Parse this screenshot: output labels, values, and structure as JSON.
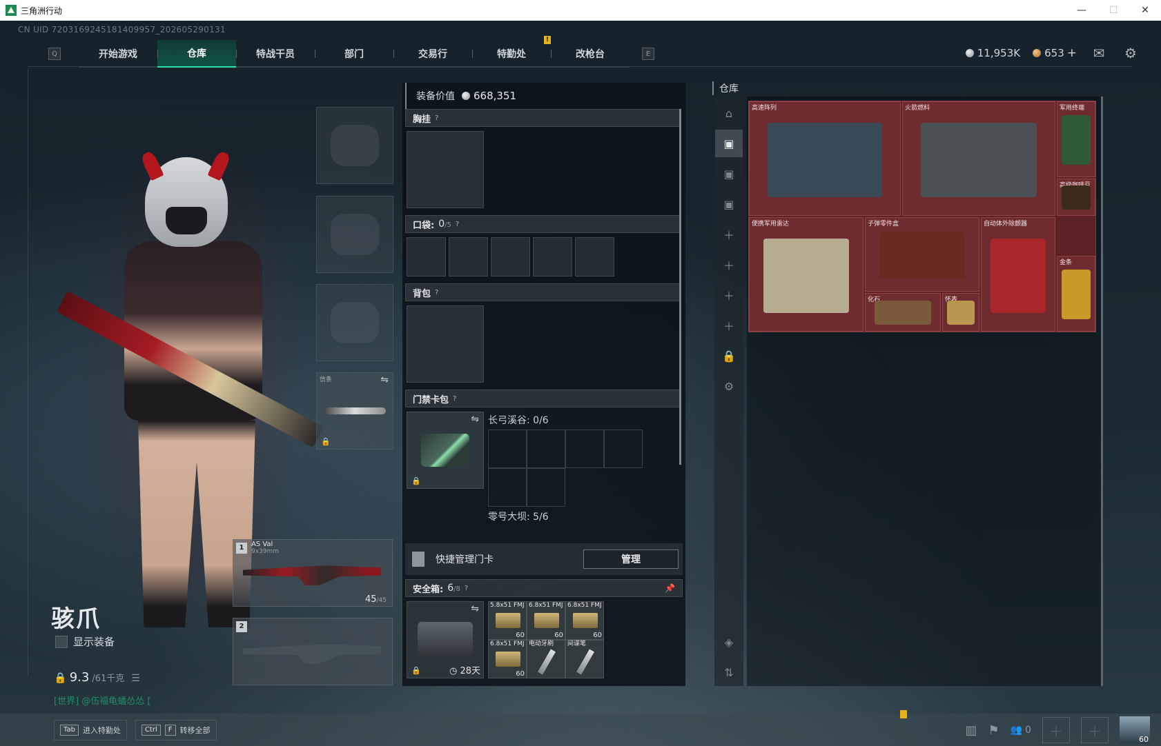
{
  "window": {
    "title": "三角洲行动",
    "minimize": "—",
    "maximize": "☐",
    "close": "✕"
  },
  "uid": "CN UID 7203169245181409957_202605290131",
  "nav": {
    "left_key": "Q",
    "right_key": "E",
    "tabs": [
      "开始游戏",
      "仓库",
      "特战干员",
      "部门",
      "交易行",
      "特勤处",
      "改枪台"
    ],
    "active_tab": "仓库",
    "alert_on": "特勤处",
    "alert_mark": "!"
  },
  "currency": {
    "silver": "11,953K",
    "bronze": "653",
    "plus": "+"
  },
  "operator": {
    "name": "骇爪",
    "show_gear_label": "显示装备",
    "weight": "9.3",
    "weight_unit": "/61千克",
    "chat": "[世界] @伍福龟蟠怂怂 ["
  },
  "gear_slots": {
    "knife_tag": "信条"
  },
  "weapons": [
    {
      "num": "1",
      "name": "AS Val",
      "caliber": "9x39mm",
      "ammo": "45",
      "ammo_max": "/45"
    },
    {
      "num": "2",
      "name": "",
      "caliber": "",
      "ammo": "",
      "ammo_max": ""
    }
  ],
  "equipment": {
    "value_label": "装备价值",
    "value": "668,351",
    "chest_rig": "胸挂",
    "pockets_label": "口袋:",
    "pockets_count": "0",
    "pockets_max": "/5",
    "backpack": "背包",
    "keycard_pack": "门禁卡包",
    "map_a": "长弓溪谷: 0/6",
    "map_b": "零号大坝: 5/6",
    "quick_manage": "快捷管理门卡",
    "manage_btn": "管理",
    "safe_label": "安全箱:",
    "safe_count": "6",
    "safe_max": "/8",
    "safe_days": "28天",
    "help": "?",
    "safe_items": [
      {
        "name": "5.8x51 FMJ",
        "qty": "60"
      },
      {
        "name": "6.8x51 FMJ",
        "qty": "60"
      },
      {
        "name": "6.8x51 FMJ",
        "qty": "60"
      },
      {
        "name": "6.8x51 FMJ",
        "qty": "60"
      },
      {
        "name": "电动牙刷",
        "qty": ""
      },
      {
        "name": "间谍笔",
        "qty": ""
      }
    ]
  },
  "warehouse": {
    "title": "仓库",
    "items": [
      {
        "name": "高速阵列",
        "color": "#3a4a56"
      },
      {
        "name": "火箭燃料",
        "color": "#4a5054"
      },
      {
        "name": "军用终端",
        "color": "#2f5a3a"
      },
      {
        "name": "高级咖啡豆",
        "color": "#3a2a1a"
      },
      {
        "name": "便携军用雷达",
        "color": "#b8ad92"
      },
      {
        "name": "子弹零件盒",
        "color": "#6a2a22"
      },
      {
        "name": "自动体外除颤器",
        "color": "#a8262c"
      },
      {
        "name": "金条",
        "color": "#c89a2a"
      },
      {
        "name": "化石",
        "color": "#7a5a3a"
      },
      {
        "name": "怀表",
        "color": "#b89650"
      }
    ]
  },
  "bottom": {
    "hint1_key": "Tab",
    "hint1": "进入特勤处",
    "hint2_key1": "Ctrl",
    "hint2_key2": "F",
    "hint2": "转移全部",
    "team_count": "0",
    "level": "60"
  }
}
